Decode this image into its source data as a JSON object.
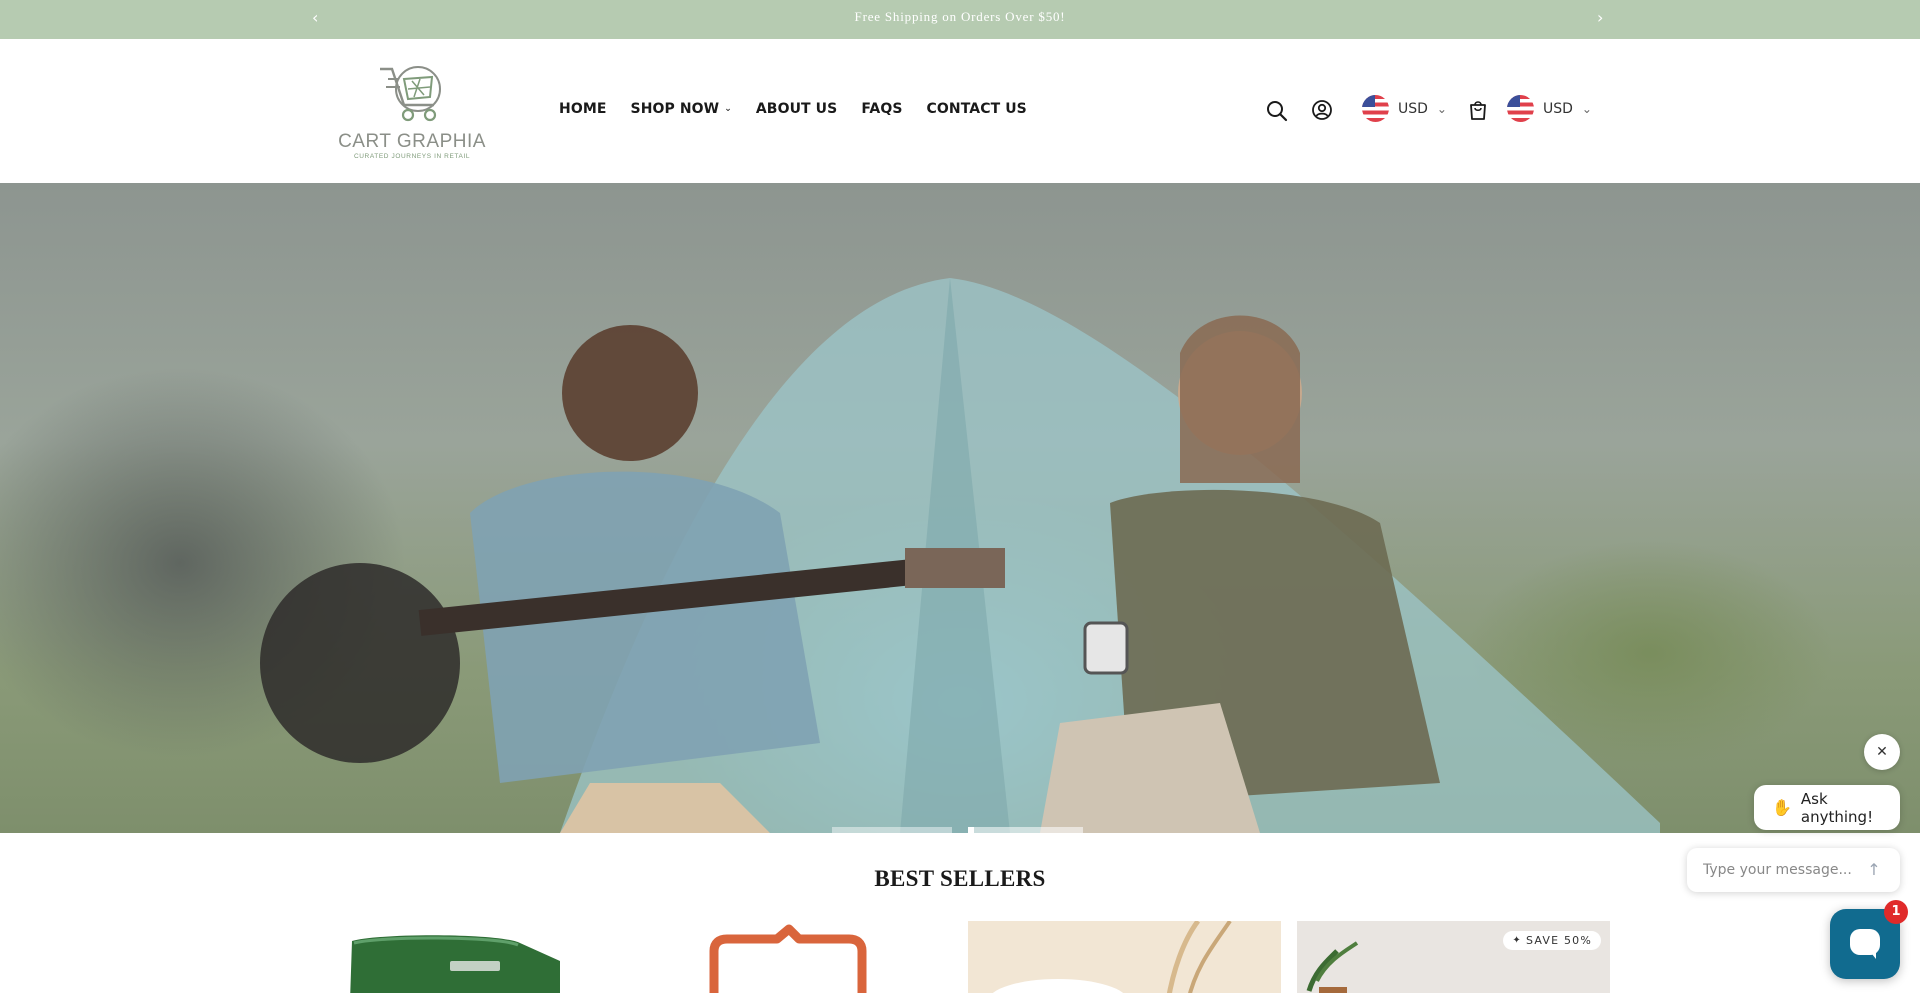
{
  "announcement": {
    "text": "Free Shipping on Orders Over $50!",
    "prev_icon": "chevron-left-icon",
    "next_icon": "chevron-right-icon"
  },
  "header": {
    "logo": {
      "brand": "CART GRAPHIA",
      "tagline": "CURATED JOURNEYS IN RETAIL"
    },
    "nav": [
      {
        "label": "HOME"
      },
      {
        "label": "SHOP NOW",
        "has_dropdown": true
      },
      {
        "label": "ABOUT US"
      },
      {
        "label": "FAQS"
      },
      {
        "label": "CONTACT US"
      }
    ],
    "icons": [
      "search-icon",
      "account-icon",
      "cart-icon"
    ],
    "currency_selectors": [
      {
        "code": "USD",
        "flag": "us-flag-icon"
      },
      {
        "code": "USD",
        "flag": "us-flag-icon"
      }
    ]
  },
  "hero": {
    "slides": 2,
    "active_slide": 1
  },
  "best_sellers": {
    "title": "BEST SELLERS",
    "products": [
      {
        "badge": ""
      },
      {
        "badge": ""
      },
      {
        "badge": ""
      },
      {
        "badge": "SAVE 50%"
      }
    ]
  },
  "chat": {
    "greeting": "Ask anything!",
    "input_placeholder": "Type your message...",
    "unread_count": "1"
  },
  "colors": {
    "announcement_bg": "#b6cbb1",
    "brand_green": "#7f9b7a",
    "chat_button": "#116b8f",
    "notification_badge": "#e02a2a"
  }
}
